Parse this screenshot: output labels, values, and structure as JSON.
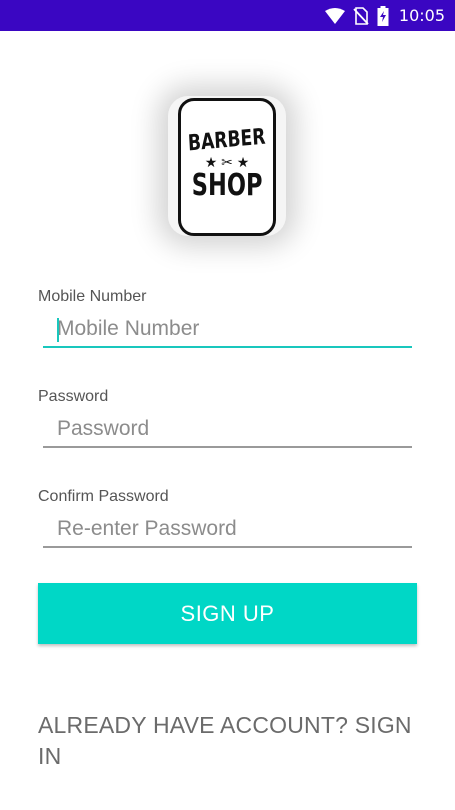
{
  "status_bar": {
    "time": "10:05",
    "icons": [
      "wifi-icon",
      "no-sim-icon",
      "battery-charging-icon"
    ],
    "background": "#3a06c2"
  },
  "logo": {
    "line1": "BARBER",
    "line2": "SHOP",
    "decoration": "★ ✂ ★"
  },
  "form": {
    "mobile": {
      "label": "Mobile Number",
      "placeholder": "Mobile Number",
      "value": ""
    },
    "password": {
      "label": "Password",
      "placeholder": "Password",
      "value": ""
    },
    "confirm": {
      "label": "Confirm Password",
      "placeholder": "Re-enter Password",
      "value": ""
    }
  },
  "actions": {
    "signup_label": "SIGN UP",
    "signin_link": "ALREADY HAVE ACCOUNT? SIGN IN"
  },
  "colors": {
    "accent": "#00d7c6",
    "focus_underline": "#19c7bd",
    "status_bar": "#3a06c2"
  }
}
